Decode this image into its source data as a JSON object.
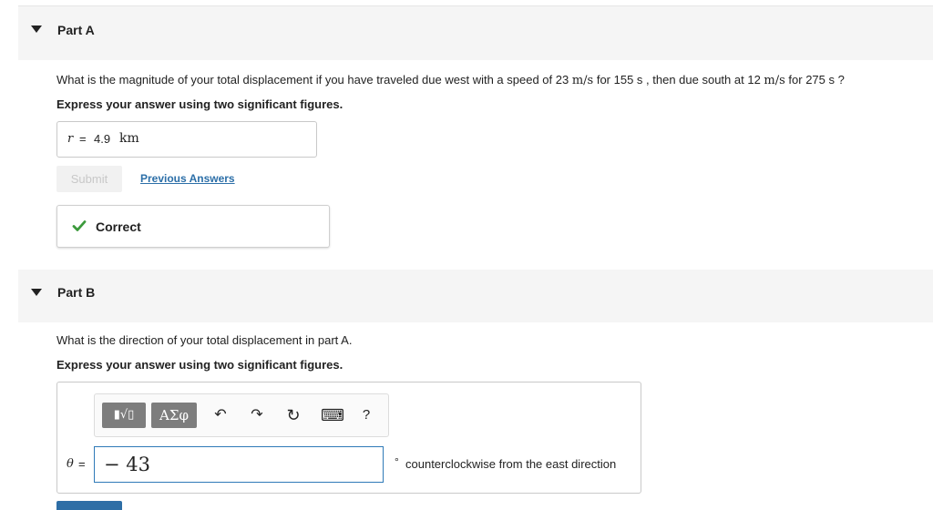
{
  "partA": {
    "title": "Part A",
    "question": {
      "pre": "What is the magnitude of your total displacement if you have traveled due west with a speed of 23 ",
      "unit1": "m/s",
      "mid": " for 155 s , then due south at 12 ",
      "unit2": "m/s",
      "post": " for 275 s ?"
    },
    "instruction": "Express your answer using two significant figures.",
    "answer": {
      "variable": "r",
      "equals": "=",
      "value": "4.9",
      "unit": "km"
    },
    "submit_label": "Submit",
    "previous_answers_label": "Previous Answers",
    "result_label": "Correct"
  },
  "partB": {
    "title": "Part B",
    "question": "What is the direction of your total displacement in part A.",
    "instruction": "Express your answer using two significant figures.",
    "toolbar": {
      "templates_label": "▮√▯",
      "greek_label": "ΑΣφ",
      "undo_icon": "↶",
      "redo_icon": "↷",
      "reset_icon": "↻",
      "keyboard_icon": "⌨",
      "help_label": "?"
    },
    "answer": {
      "variable": "θ",
      "equals": "=",
      "value": "− 43"
    },
    "degree_symbol": "°",
    "direction_text": "counterclockwise from the east direction"
  },
  "colors": {
    "accent": "#2f7ab8",
    "link": "#2c6fa8",
    "check": "#3c9a3c",
    "header_bg": "#f5f5f5"
  }
}
